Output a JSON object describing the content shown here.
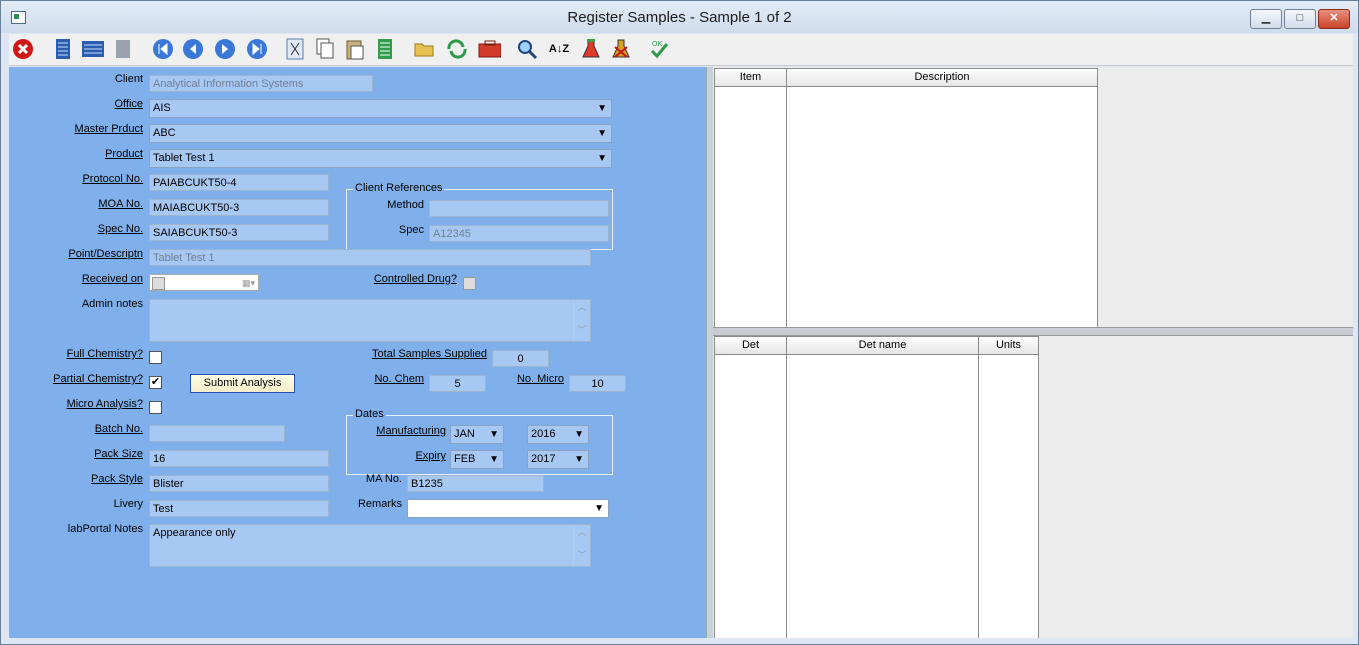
{
  "window": {
    "title": "Register Samples -  Sample 1 of 2",
    "minimize": "▁",
    "maximize": "□",
    "close": "✕"
  },
  "toolbar": {
    "icons": [
      "close-icon",
      "list-icon",
      "grid-icon",
      "page-icon",
      "first-icon",
      "prev-icon",
      "next-icon",
      "last-icon",
      "cut-icon",
      "copy-icon",
      "paste-icon",
      "document-icon",
      "open-folder-icon",
      "refresh-icon",
      "toolbox-icon",
      "search-icon",
      "sort-az-icon",
      "flask-icon",
      "flask-x-icon",
      "ok-check-icon"
    ]
  },
  "form": {
    "client": {
      "label": "Client",
      "value": "Analytical Information Systems"
    },
    "office": {
      "label": "Office",
      "value": "AIS"
    },
    "master_product": {
      "label": "Master Prduct",
      "value": "ABC"
    },
    "product": {
      "label": "Product",
      "value": "Tablet Test 1"
    },
    "protocol": {
      "label": "Protocol No.",
      "value": "PAIABCUKT50-4"
    },
    "moa": {
      "label": "MOA No.",
      "value": "MAIABCUKT50-3"
    },
    "spec_no": {
      "label": "Spec No.",
      "value": "SAIABCUKT50-3"
    },
    "point": {
      "label": "Point/Descriptn",
      "value": "Tablet Test 1"
    },
    "received": {
      "label": "Received on",
      "value": ""
    },
    "controlled": {
      "label": "Controlled Drug?"
    },
    "admin_notes": {
      "label": "Admin notes",
      "value": ""
    },
    "client_refs": {
      "label": "Client References",
      "method_label": "Method",
      "method": "",
      "spec_label": "Spec",
      "spec": "A12345"
    },
    "full_chem": {
      "label": "Full Chemistry?",
      "checked": false
    },
    "partial_chem": {
      "label": "Partial Chemistry?",
      "checked": true,
      "mark": "✔"
    },
    "micro": {
      "label": "Micro Analysis?",
      "checked": false
    },
    "submit": "Submit Analysis",
    "total_samples": {
      "label": "Total Samples Supplied",
      "value": "0"
    },
    "no_chem": {
      "label": "No. Chem",
      "value": "5"
    },
    "no_micro": {
      "label": "No. Micro",
      "value": "10"
    },
    "batch": {
      "label": "Batch No.",
      "value": ""
    },
    "pack_size": {
      "label": "Pack Size",
      "value": "16"
    },
    "pack_style": {
      "label": "Pack Style",
      "value": "Blister"
    },
    "livery": {
      "label": "Livery",
      "value": "Test"
    },
    "notes": {
      "label": "labPortal Notes",
      "value": "Appearance only"
    },
    "dates": {
      "label": "Dates",
      "manufacturing_label": "Manufacturing",
      "mfg_month": "JAN",
      "mfg_year": "2016",
      "expiry_label": "Expiry",
      "exp_month": "FEB",
      "exp_year": "2017"
    },
    "ma_no": {
      "label": "MA No.",
      "value": "B1235"
    },
    "remarks": {
      "label": "Remarks",
      "value": ""
    }
  },
  "grid_top": {
    "columns": [
      "Item",
      "Description"
    ]
  },
  "grid_bottom": {
    "columns": [
      "Det",
      "Det name",
      "Units"
    ]
  }
}
